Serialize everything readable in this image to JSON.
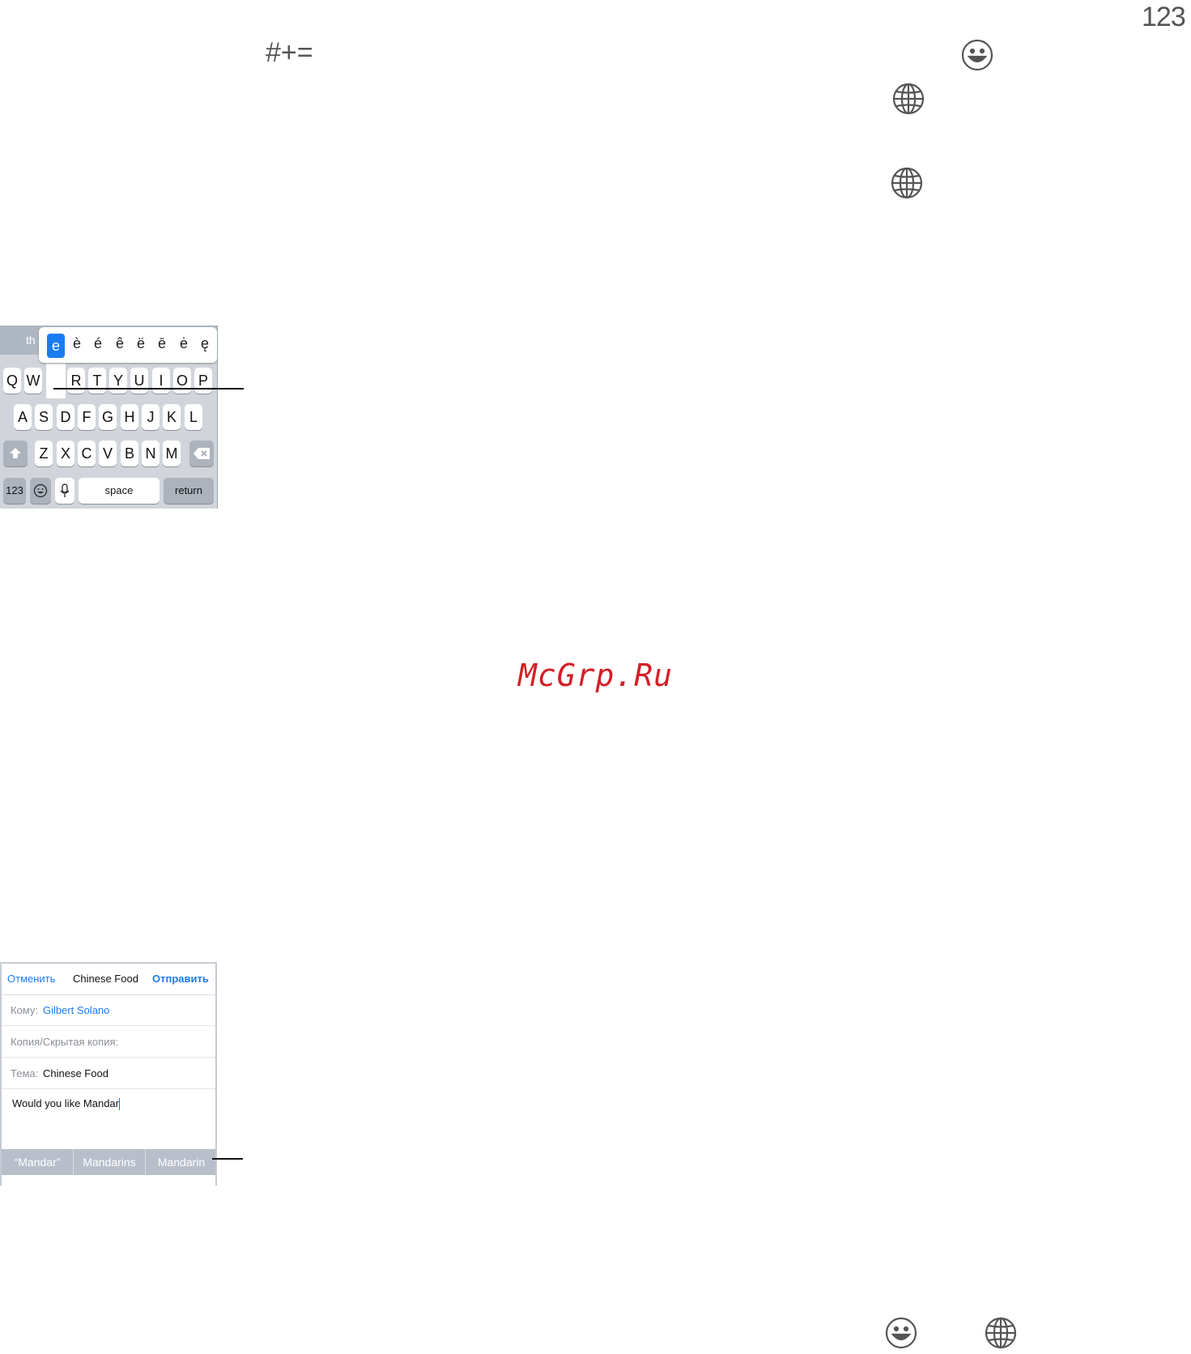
{
  "page_number": "123",
  "symbols_key": "#+=",
  "icons": {
    "emoji_top": "emoji-icon",
    "globe_1": "globe-icon",
    "globe_2": "globe-icon",
    "emoji_bottom": "emoji-icon",
    "globe_bottom": "globe-icon"
  },
  "keyboard": {
    "topbar_fragment": "th",
    "accent_options": [
      "e",
      "è",
      "é",
      "ê",
      "ë",
      "ē",
      "ė",
      "ę"
    ],
    "row1": [
      "Q",
      "W",
      "R",
      "T",
      "Y",
      "U",
      "I",
      "O",
      "P"
    ],
    "row2": [
      "A",
      "S",
      "D",
      "F",
      "G",
      "H",
      "J",
      "K",
      "L"
    ],
    "row3": [
      "Z",
      "X",
      "C",
      "V",
      "B",
      "N",
      "M"
    ],
    "numbers_key": "123",
    "space_key": "space",
    "return_key": "return"
  },
  "mail": {
    "cancel": "Отменить",
    "title": "Chinese Food",
    "send": "Отправить",
    "to_label": "Кому:",
    "to_value": "Gilbert Solano",
    "cc_label": "Копия/Скрытая копия:",
    "subject_label": "Тема:",
    "subject_value": "Chinese Food",
    "body": "Would you like Mandar",
    "suggestions": [
      "“Mandar”",
      "Mandarins",
      "Mandarin"
    ]
  },
  "watermark": "McGrp.Ru"
}
